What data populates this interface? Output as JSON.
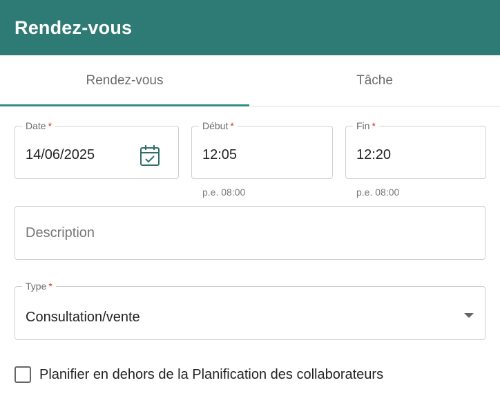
{
  "header": {
    "title": "Rendez-vous"
  },
  "tabs": [
    {
      "label": "Rendez-vous",
      "active": true
    },
    {
      "label": "Tâche",
      "active": false
    }
  ],
  "form": {
    "date": {
      "label": "Date",
      "required_mark": "*",
      "value": "14/06/2025",
      "icon": "calendar-check-icon"
    },
    "debut": {
      "label": "Début",
      "required_mark": "*",
      "value": "12:05",
      "helper": "p.e. 08:00"
    },
    "fin": {
      "label": "Fin",
      "required_mark": "*",
      "value": "12:20",
      "helper": "p.e. 08:00"
    },
    "description": {
      "placeholder": "Description"
    },
    "type": {
      "label": "Type",
      "required_mark": "*",
      "value": "Consultation/vente",
      "icon": "dropdown-caret-icon"
    },
    "schedule_outside": {
      "label": "Planifier en dehors de la Planification des collaborateurs",
      "checked": false
    }
  },
  "colors": {
    "header_bg": "#2e7a74",
    "accent": "#2e8a84",
    "required": "#d32f2f"
  }
}
